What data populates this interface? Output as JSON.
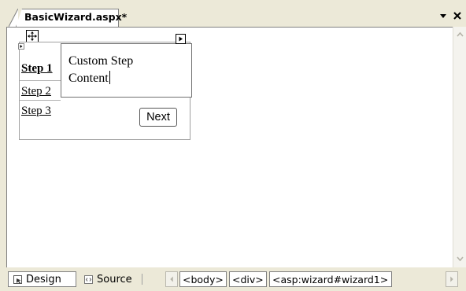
{
  "document_tab": {
    "title": "BasicWizard.aspx*"
  },
  "tab_controls": {
    "dropdown_icon": "dropdown-arrow-icon",
    "close_icon": "close-icon"
  },
  "wizard": {
    "sidebar_steps": [
      "Step 1",
      "Step 2",
      "Step 3"
    ],
    "active_step_index": 0,
    "content_line1": "Custom Step",
    "content_line2": "Content",
    "next_button": "Next"
  },
  "view_tabs": {
    "design": "Design",
    "source": "Source",
    "active": "Design"
  },
  "breadcrumbs": [
    "<body>",
    "<div>",
    "<asp:wizard#wizard1>"
  ],
  "colors": {
    "chrome": "#ece9d8",
    "surface": "#ffffff",
    "border": "#808080"
  }
}
